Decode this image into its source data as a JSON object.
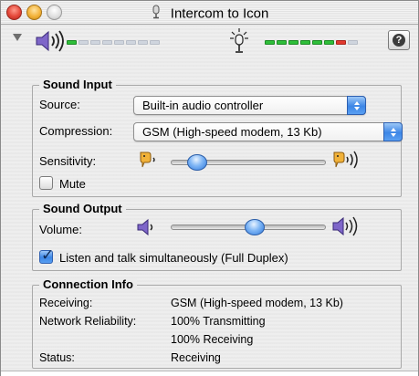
{
  "window": {
    "title": "Intercom to Icon"
  },
  "levels": {
    "output_meter": {
      "segments": 8,
      "lit": 1,
      "colors": {
        "on": "#2fbf3a",
        "off": "#cfd5de"
      }
    },
    "input_meter": {
      "segments": 8,
      "lit_green": 6,
      "lit_red": 1
    }
  },
  "sound_input": {
    "title": "Sound Input",
    "source_label": "Source:",
    "source_value": "Built-in audio controller",
    "compression_label": "Compression:",
    "compression_value": "GSM (High-speed modem, 13 Kb)",
    "sensitivity_label": "Sensitivity:",
    "sensitivity_level": 0.12,
    "mute_label": "Mute",
    "mute_checked": false
  },
  "sound_output": {
    "title": "Sound Output",
    "volume_label": "Volume:",
    "volume_level": 0.55,
    "full_duplex_label": "Listen and talk simultaneously (Full Duplex)",
    "full_duplex_checked": true
  },
  "connection_info": {
    "title": "Connection Info",
    "rows": [
      {
        "label": "Receiving:",
        "value": "GSM (High-speed modem, 13 Kb)"
      },
      {
        "label": "Network Reliability:",
        "value": "100% Transmitting"
      },
      {
        "label": "",
        "value": "100% Receiving"
      },
      {
        "label": "Status:",
        "value": "Receiving"
      }
    ]
  },
  "colors": {
    "accent": "#3c86e6",
    "window_bg": "#ececec"
  }
}
